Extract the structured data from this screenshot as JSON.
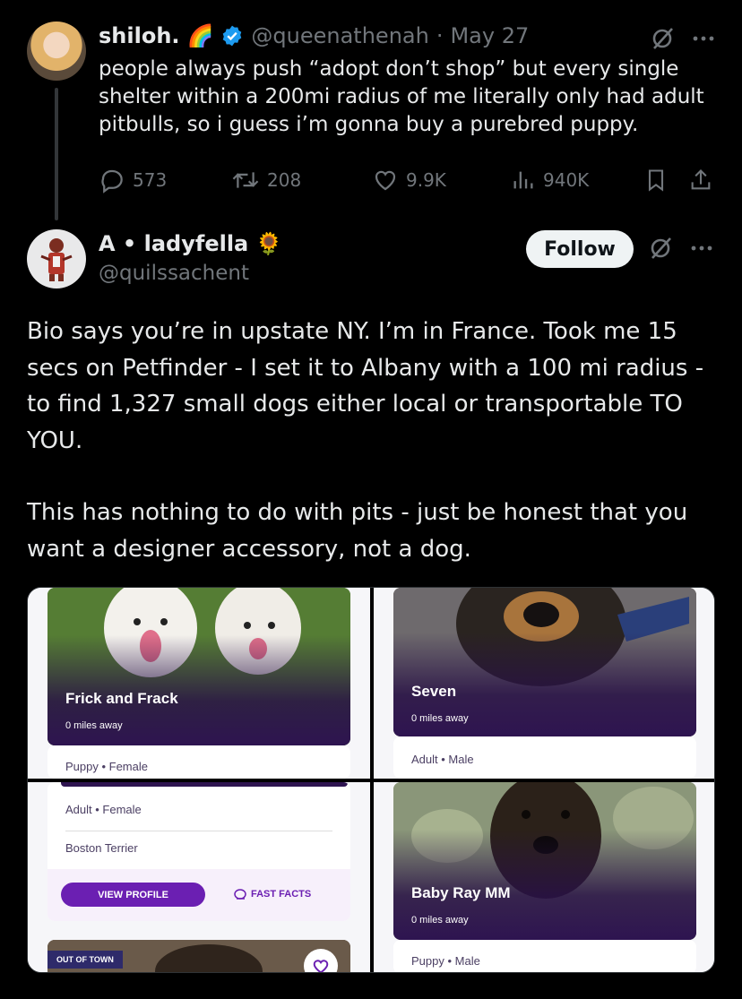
{
  "tweet1": {
    "name": "shiloh.",
    "emoji": "🌈",
    "handle": "@queenathenah",
    "sep": "·",
    "date": "May 27",
    "text": "people always push “adopt don’t shop” but every single shelter within a 200mi radius of me literally only had adult pitbulls, so i guess i’m gonna buy a purebred puppy.",
    "replies": "573",
    "reposts": "208",
    "likes": "9.9K",
    "views": "940K"
  },
  "tweet2": {
    "name": "A • ladyfella",
    "emoji": "🌻",
    "handle": "@quilssachent",
    "follow_label": "Follow",
    "paragraphs": [
      "Bio says you’re in upstate NY. I’m in France. Took me 15 secs on Petfinder - I set it to Albany with a 100 mi radius - to find 1,327 small dogs either local or transportable TO YOU.",
      "This has nothing to do with pits - just be honest that you want a designer accessory, not a dog."
    ]
  },
  "media": {
    "card1": {
      "name": "Frick and Frack",
      "distance": "0 miles away",
      "info": "Puppy • Female"
    },
    "card2": {
      "name": "Seven",
      "distance": "0 miles away",
      "info": "Adult • Male"
    },
    "card3": {
      "info": "Adult • Female",
      "breed": "Boston Terrier",
      "view_profile": "VIEW PROFILE",
      "fast_facts": "FAST FACTS",
      "badge": "OUT OF TOWN"
    },
    "card4": {
      "name": "Baby Ray MM",
      "distance": "0 miles away",
      "info": "Puppy • Male"
    }
  },
  "colors": {
    "background": "#000000",
    "text": "#e7e9ea",
    "muted": "#71767b",
    "verified": "#1d9bf0",
    "petfinder_purple": "#6b1fb2"
  },
  "icons": [
    "verified-badge-icon",
    "grok-icon",
    "more-icon",
    "reply-icon",
    "repost-icon",
    "like-icon",
    "views-icon",
    "bookmark-icon",
    "share-icon",
    "heart-icon",
    "fast-facts-icon"
  ]
}
